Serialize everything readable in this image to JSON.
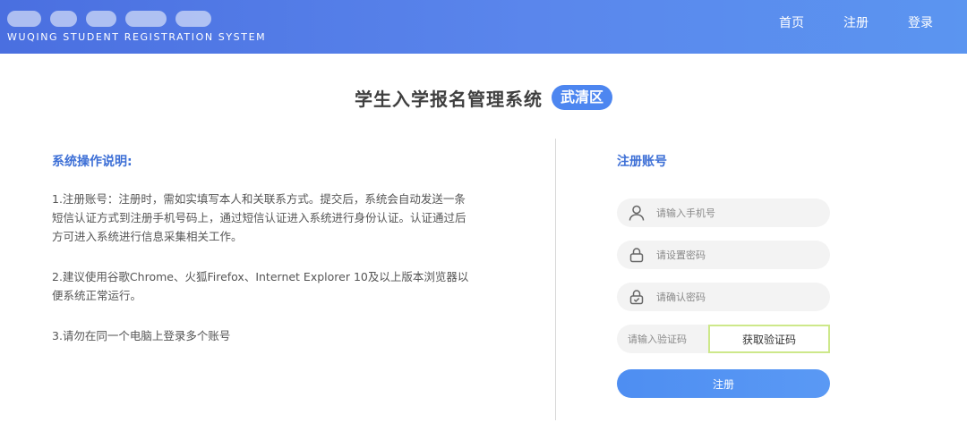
{
  "header": {
    "system_name_en": "WUQING STUDENT REGISTRATION SYSTEM",
    "nav": [
      {
        "label": "首页"
      },
      {
        "label": "注册"
      },
      {
        "label": "登录"
      }
    ],
    "colors": {
      "bar_left": "#4a6fe0",
      "bar_right": "#5b95f0"
    }
  },
  "title": {
    "text": "学生入学报名管理系统",
    "district": "武清区"
  },
  "instructions": {
    "heading": "系统操作说明:",
    "items": [
      "1.注册账号：注册时，需如实填写本人和关联系方式。提交后，系统会自动发送一条短信认证方式到注册手机号码上，通过短信认证进入系统进行身份认证。认证通过后方可进入系统进行信息采集相关工作。",
      "2.建议使用谷歌Chrome、火狐Firefox、Internet Explorer 10及以上版本浏览器以便系统正常运行。",
      "3.请勿在同一个电脑上登录多个账号"
    ]
  },
  "register": {
    "heading": "注册账号",
    "phone_placeholder": "请输入手机号",
    "password_placeholder": "请设置密码",
    "confirm_placeholder": "请确认密码",
    "code_placeholder": "请输入验证码",
    "get_code_label": "获取验证码",
    "submit_label": "注册",
    "icons": {
      "phone": "user-icon",
      "password": "lock-icon",
      "confirm": "lock-check-icon"
    }
  }
}
